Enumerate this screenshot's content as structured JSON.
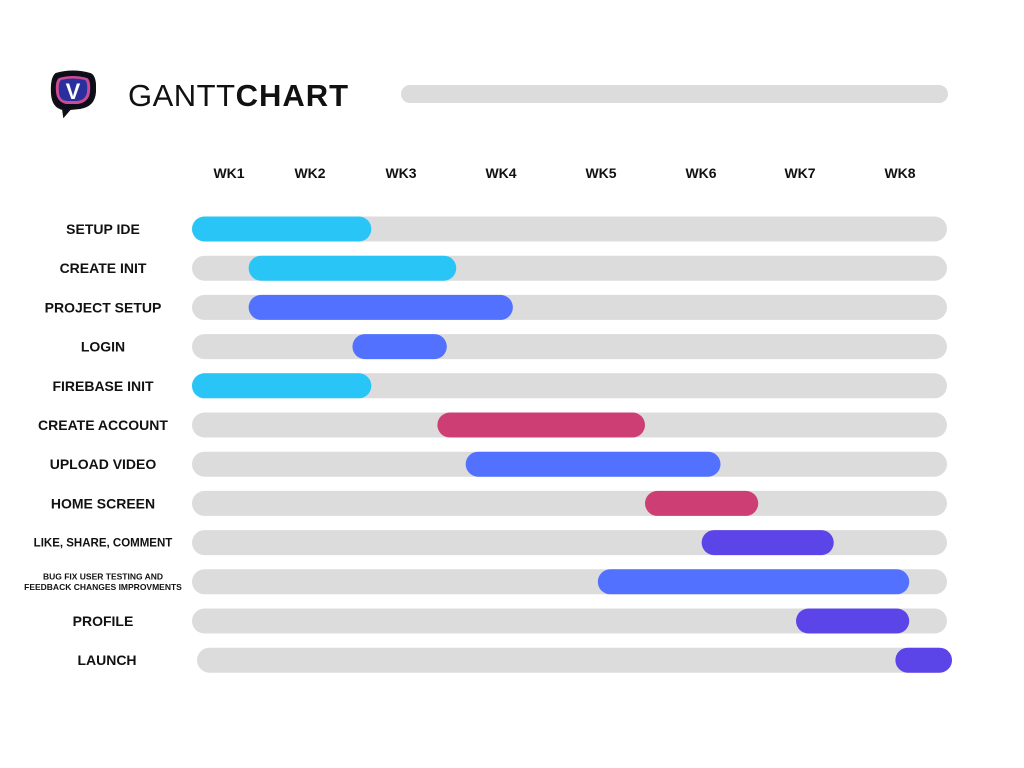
{
  "header": {
    "title_light": "GANTT",
    "title_bold": "CHART",
    "logo_icon": "v-chat-bubble-logo",
    "logo_letter": "V"
  },
  "colors": {
    "track": "#dcdcdc",
    "cyan": "#29c5f6",
    "blue": "#5271ff",
    "pink": "#cd3f74",
    "purple": "#5b45e8"
  },
  "chart_data": {
    "type": "gantt",
    "title": "GANTT CHART",
    "x_unit": "weeks",
    "categories": [
      "WK1",
      "WK2",
      "WK3",
      "WK4",
      "WK5",
      "WK6",
      "WK7",
      "WK8"
    ],
    "tasks": [
      {
        "label": "SETUP IDE",
        "start": 0.0,
        "end": 1.9,
        "color": "#29c5f6"
      },
      {
        "label": "CREATE INIT",
        "start": 0.6,
        "end": 2.8,
        "color": "#29c5f6"
      },
      {
        "label": "PROJECT SETUP",
        "start": 0.6,
        "end": 3.4,
        "color": "#5271ff"
      },
      {
        "label": "LOGIN",
        "start": 1.7,
        "end": 2.7,
        "color": "#5271ff"
      },
      {
        "label": "FIREBASE INIT",
        "start": 0.0,
        "end": 1.9,
        "color": "#29c5f6"
      },
      {
        "label": "CREATE ACCOUNT",
        "start": 2.6,
        "end": 4.8,
        "color": "#cd3f74"
      },
      {
        "label": "UPLOAD VIDEO",
        "start": 2.9,
        "end": 5.6,
        "color": "#5271ff"
      },
      {
        "label": "HOME SCREEN",
        "start": 4.8,
        "end": 6.0,
        "color": "#cd3f74"
      },
      {
        "label": "LIKE, SHARE, COMMENT",
        "start": 5.4,
        "end": 6.8,
        "color": "#5b45e8"
      },
      {
        "label": "BUG FIX USER TESTING AND FEEDBACK CHANGES IMPROVMENTS",
        "start": 4.3,
        "end": 7.6,
        "color": "#5271ff"
      },
      {
        "label": "PROFILE",
        "start": 6.4,
        "end": 7.6,
        "color": "#5b45e8"
      },
      {
        "label": "LAUNCH",
        "start": 7.4,
        "end": 8.0,
        "color": "#5b45e8"
      }
    ]
  }
}
